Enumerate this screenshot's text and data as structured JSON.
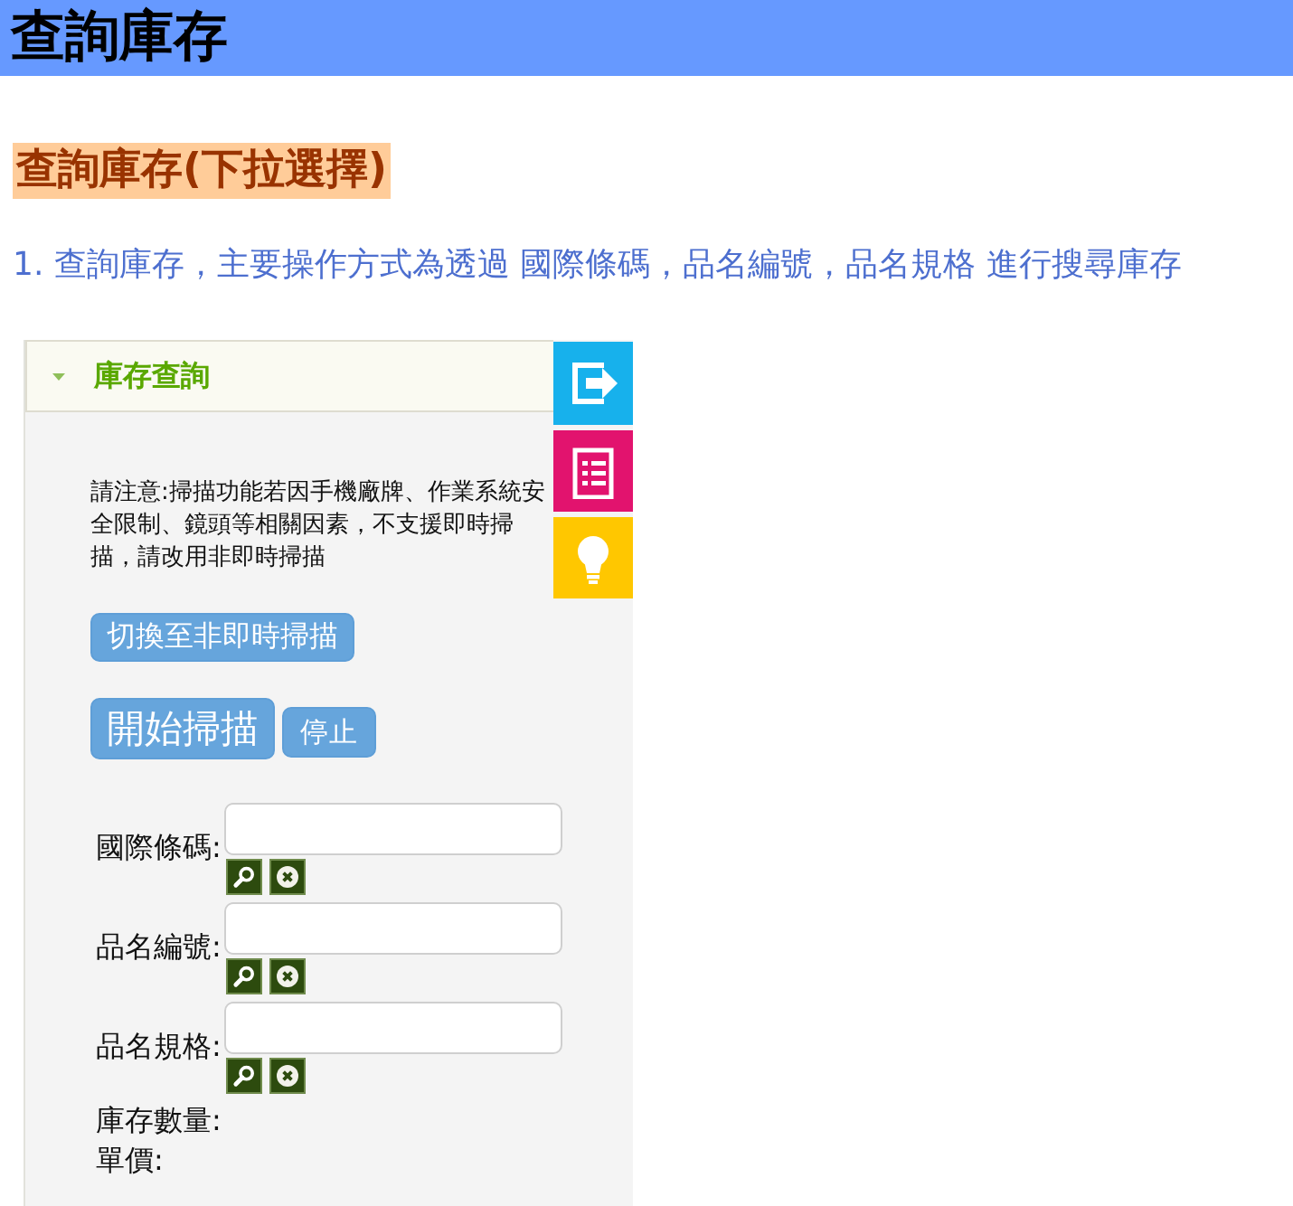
{
  "page_header": {
    "title": "查詢庫存"
  },
  "section_heading": "查詢庫存(下拉選擇)",
  "intro": "1. 查詢庫存，主要操作方式為透過 國際條碼，品名編號，品名規格 進行搜尋庫存",
  "app_screenshot": {
    "panel": {
      "title": "庫存查詢",
      "expanded": true
    },
    "side_tabs": [
      {
        "kind": "exit",
        "color": "#17b1ec"
      },
      {
        "kind": "list",
        "color": "#e2136e"
      },
      {
        "kind": "tip",
        "color": "#ffc700"
      }
    ],
    "notice": "請注意:掃描功能若因手機廠牌、作業系統安全限制、鏡頭等相關因素，不支援即時掃描，請改用非即時掃描",
    "mode_button": {
      "label": "切換至非即時掃描"
    },
    "scan_buttons": [
      {
        "label": "開始掃描",
        "kind": "large"
      },
      {
        "label": "停止",
        "kind": "small"
      }
    ],
    "fields": [
      {
        "label": "國際條碼:"
      },
      {
        "label": "品名編號:"
      },
      {
        "label": "品名規格:"
      }
    ],
    "readouts": [
      {
        "label": "庫存數量:"
      },
      {
        "label": "單價:"
      }
    ]
  }
}
